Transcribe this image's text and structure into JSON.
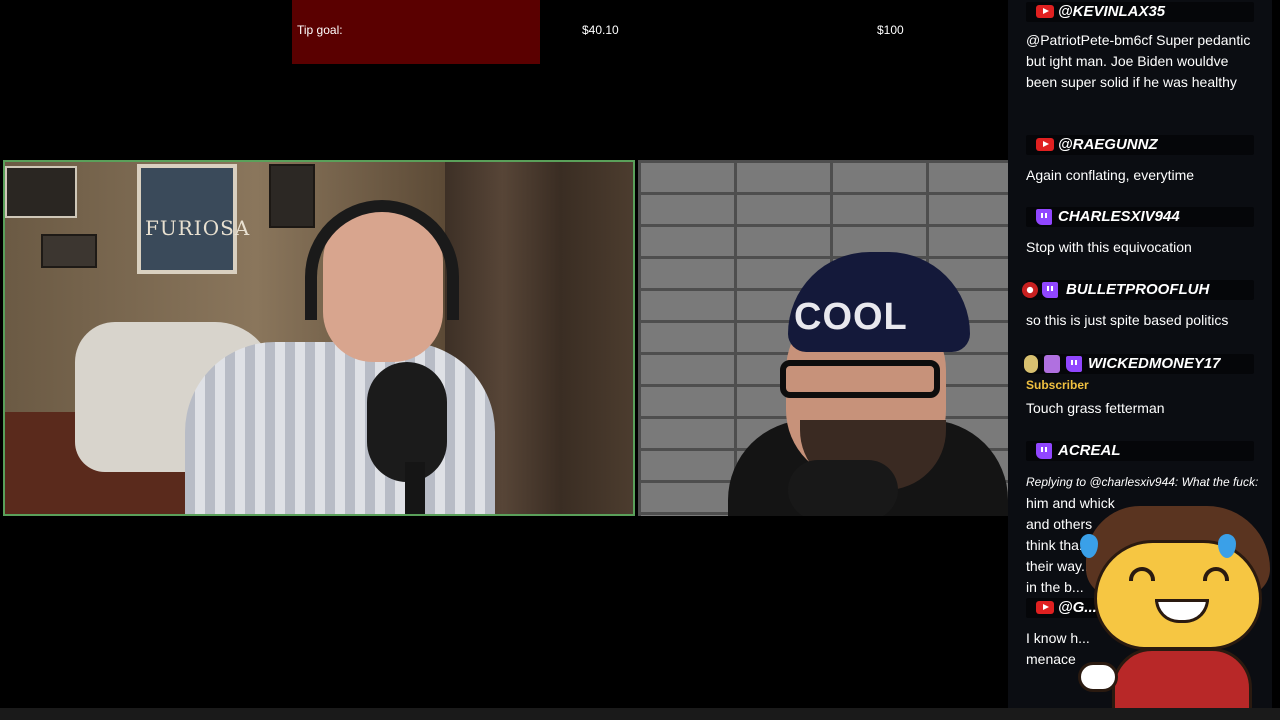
{
  "tip_goal": {
    "label": "Tip goal:",
    "current": "$40.10",
    "target": "$100",
    "progress": 0.401,
    "fill_color": "#5a0000"
  },
  "cameras": {
    "left": {
      "poster_text": "FURIOSA",
      "border_color": "#5aa05a"
    },
    "right": {
      "beanie_text": "COOL"
    }
  },
  "chat": {
    "messages": [
      {
        "platform": "youtube",
        "name": "@KEVINLAX35",
        "text": "@PatriotPete-bm6cf Super pedantic but ight man. Joe Biden wouldve been super solid if he was healthy"
      },
      {
        "platform": "youtube",
        "name": "@RAEGUNNZ",
        "text": "Again conflating, everytime"
      },
      {
        "platform": "twitch",
        "name": "CHARLESXIV944",
        "text": "Stop with this equivocation"
      },
      {
        "platform": "twitch",
        "name": "BULLETPROOFLUH",
        "text": "so this is just spite based politics"
      },
      {
        "platform": "twitch",
        "name": "WICKEDMONEY17",
        "badge": "Subscriber",
        "text": "Touch grass fetterman"
      },
      {
        "platform": "twitch",
        "name": "ACREAL",
        "reply": "Replying to @charlesxiv944: What the fuck:",
        "text": "him and whick and others think tha... their way... is in the b..."
      },
      {
        "platform": "youtube",
        "name": "@G...",
        "text": "I know h... menace"
      }
    ]
  },
  "colors": {
    "youtube": "#e02020",
    "twitch": "#9146ff",
    "subscriber": "#f0c040"
  },
  "icons": [
    "youtube-icon",
    "twitch-icon",
    "mascot-emote"
  ]
}
